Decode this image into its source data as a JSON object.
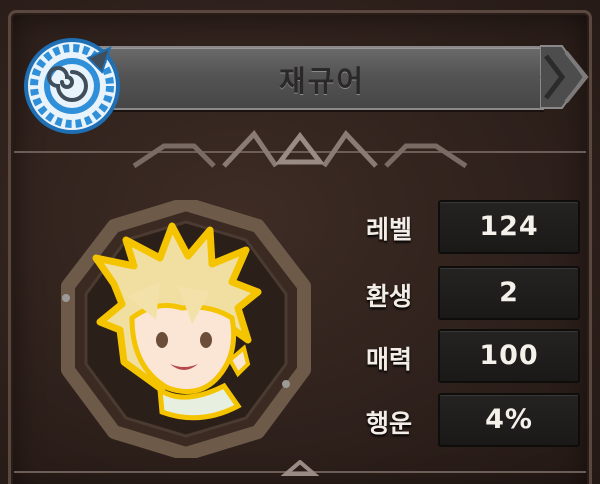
{
  "character": {
    "name": "재규어"
  },
  "stats": [
    {
      "label": "레벨",
      "value": "124"
    },
    {
      "label": "환생",
      "value": "2"
    },
    {
      "label": "매력",
      "value": "100"
    },
    {
      "label": "행운",
      "value": "4%"
    }
  ],
  "icons": {
    "emblem": "spiral-compass-emblem-icon",
    "banner_tail": "double-chevron-right-icon",
    "portrait": "character-portrait"
  },
  "colors": {
    "panel_bg": "#2f211c",
    "banner": "#555454",
    "emblem_blue": "#2f8fd8",
    "stat_box": "#1f1e1d",
    "text_light": "#f4f1ea",
    "portrait_ring": "#6e5a48"
  }
}
